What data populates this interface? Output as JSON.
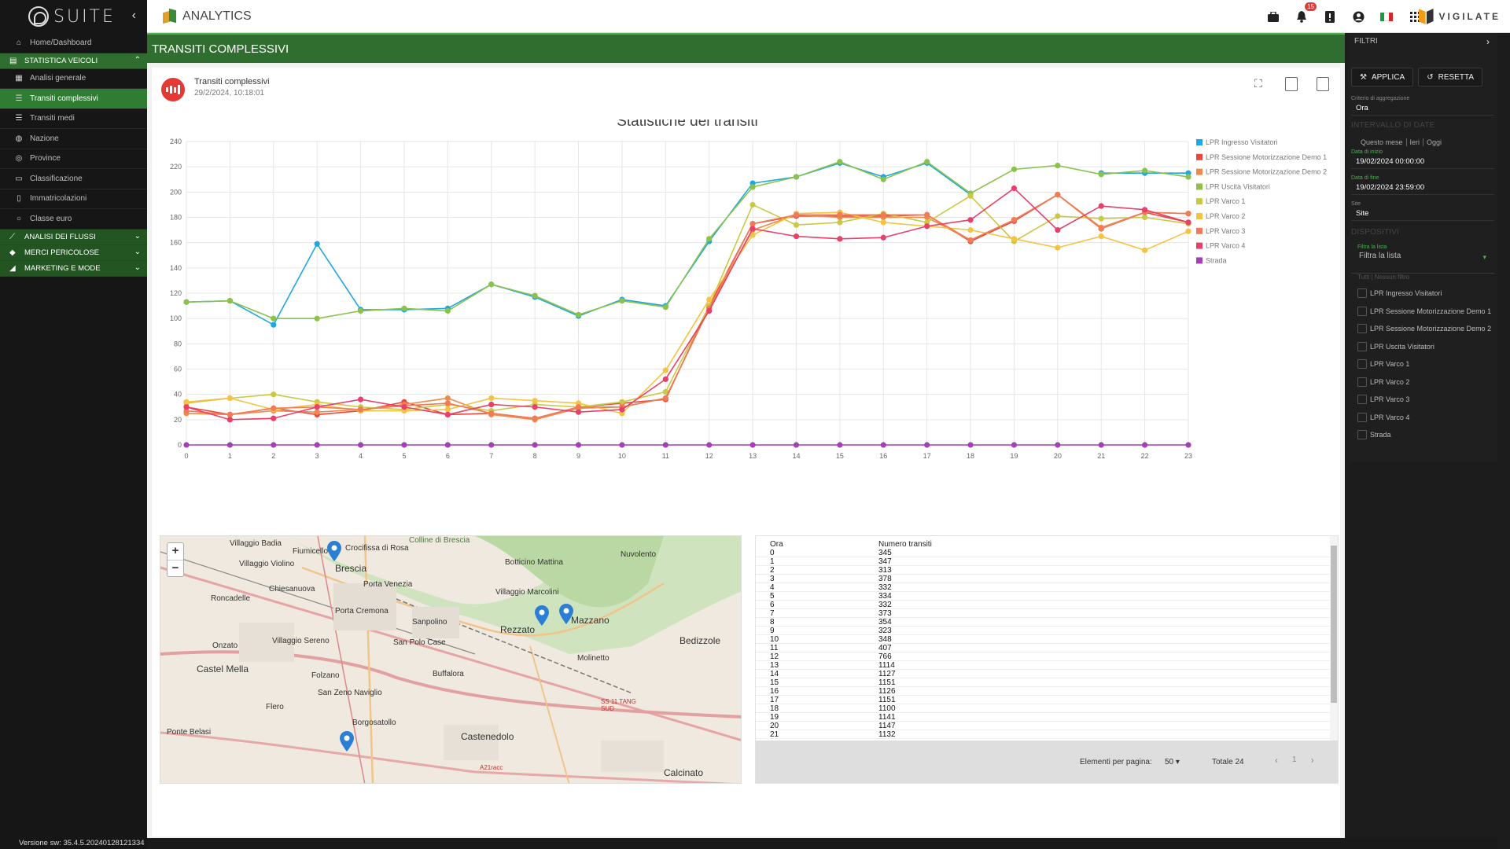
{
  "sidebar": {
    "logo": "SUITE",
    "items": [
      {
        "label": "Home/Dashboard",
        "icon": "home-icon"
      },
      {
        "label": "Analisi generale",
        "icon": "table-icon"
      },
      {
        "label": "Transiti complessivi",
        "icon": "list-icon",
        "active": true
      },
      {
        "label": "Transiti medi",
        "icon": "list-icon"
      },
      {
        "label": "Nazione",
        "icon": "globe-icon"
      },
      {
        "label": "Province",
        "icon": "target-icon"
      },
      {
        "label": "Classificazione",
        "icon": "truck-icon"
      },
      {
        "label": "Immatricolazioni",
        "icon": "doc-icon"
      },
      {
        "label": "Classe euro",
        "icon": "circle-icon"
      }
    ],
    "groups": {
      "statistica": "STATISTICA VEICOLI",
      "flussi": "ANALISI DEI FLUSSI",
      "merci": "MERCI PERICOLOSE",
      "marketing": "MARKETING E MODE"
    },
    "version": "Versione sw: 35.4.5.20240128121334"
  },
  "topbar": {
    "app_name": "ANALYTICS",
    "notifications_count": "15",
    "brand": "VIGILATE"
  },
  "page": {
    "title": "TRANSITI COMPLESSIVI",
    "card_title": "Transiti complessivi",
    "card_date": "29/2/2024, 10:18:01"
  },
  "chart_data": {
    "type": "line",
    "title": "Statistiche dei transiti",
    "x": [
      0,
      1,
      2,
      3,
      4,
      5,
      6,
      7,
      8,
      9,
      10,
      11,
      12,
      13,
      14,
      15,
      16,
      17,
      18,
      19,
      20,
      21,
      22,
      23
    ],
    "ylim": [
      0,
      240
    ],
    "yticks": [
      0,
      20,
      40,
      60,
      80,
      100,
      120,
      140,
      160,
      180,
      200,
      220,
      240
    ],
    "grid": true,
    "legend": "right",
    "series": [
      {
        "name": "LPR Ingresso Visitatori",
        "color": "#1ea7e1",
        "values": [
          113,
          114,
          95,
          159,
          107,
          107,
          108,
          127,
          117,
          102,
          115,
          110,
          161,
          207,
          212,
          223,
          212,
          223,
          198,
          null,
          null,
          215,
          215,
          215
        ]
      },
      {
        "name": "LPR Sessione Motorizzazione Demo 1",
        "color": "#e8493c",
        "values": [
          30,
          24,
          29,
          24,
          27,
          34,
          24,
          25,
          21,
          30,
          33,
          36,
          110,
          175,
          181,
          181,
          181,
          182,
          161,
          177,
          198,
          171,
          184,
          176
        ]
      },
      {
        "name": "LPR Sessione Motorizzazione Demo 2",
        "color": "#f08a4b",
        "values": [
          25,
          24,
          27,
          26,
          28,
          32,
          37,
          24,
          20,
          29,
          30,
          37,
          108,
          170,
          182,
          180,
          180,
          180,
          162,
          178,
          198,
          172,
          184,
          183
        ]
      },
      {
        "name": "LPR Uscita Visitatori",
        "color": "#8bc34a",
        "values": [
          113,
          114,
          100,
          100,
          106,
          108,
          106,
          127,
          118,
          103,
          114,
          109,
          163,
          204,
          212,
          224,
          210,
          224,
          199,
          218,
          221,
          214,
          217,
          212
        ]
      },
      {
        "name": "LPR Varco 1",
        "color": "#c9c943",
        "values": [
          33,
          37,
          40,
          34,
          30,
          28,
          32,
          27,
          32,
          30,
          34,
          42,
          110,
          190,
          174,
          176,
          183,
          176,
          197,
          161,
          181,
          179,
          180,
          175
        ]
      },
      {
        "name": "LPR Varco 2",
        "color": "#f5c242",
        "values": [
          34,
          37,
          28,
          32,
          27,
          27,
          28,
          37,
          35,
          33,
          25,
          59,
          115,
          166,
          183,
          184,
          176,
          173,
          170,
          163,
          156,
          165,
          154,
          169
        ]
      },
      {
        "name": "LPR Varco 3",
        "color": "#f07b55",
        "values": [
          27,
          24,
          29,
          30,
          28,
          31,
          33,
          25,
          21,
          30,
          30,
          37,
          108,
          175,
          182,
          182,
          182,
          182,
          162,
          178,
          198,
          171,
          184,
          183
        ]
      },
      {
        "name": "LPR Varco 4",
        "color": "#e93f6b",
        "values": [
          30,
          20,
          21,
          30,
          36,
          30,
          24,
          32,
          30,
          26,
          28,
          52,
          106,
          171,
          165,
          163,
          164,
          173,
          178,
          203,
          170,
          189,
          186,
          176
        ]
      },
      {
        "name": "Strada",
        "color": "#a43fb5",
        "values": [
          0,
          0,
          0,
          0,
          0,
          0,
          0,
          0,
          0,
          0,
          0,
          0,
          0,
          0,
          0,
          0,
          0,
          0,
          0,
          0,
          0,
          0,
          0,
          0
        ]
      }
    ]
  },
  "map": {
    "labels": [
      {
        "text": "Villaggio Badia",
        "big": false
      },
      {
        "text": "Fiumicello",
        "big": false
      },
      {
        "text": "Crocifissa di Rosa",
        "big": false
      },
      {
        "text": "Brescia",
        "big": true
      },
      {
        "text": "Colline di Brescia",
        "big": false
      },
      {
        "text": "Botticino Mattina",
        "big": false
      },
      {
        "text": "Nuvolento",
        "big": false
      },
      {
        "text": "Villaggio Violino",
        "big": false
      },
      {
        "text": "Chiesanuova",
        "big": false
      },
      {
        "text": "Porta Venezia",
        "big": false
      },
      {
        "text": "Villaggio Marcolini",
        "big": false
      },
      {
        "text": "Roncadelle",
        "big": false
      },
      {
        "text": "Porta Cremona",
        "big": false
      },
      {
        "text": "Sanpolino",
        "big": false
      },
      {
        "text": "Mazzano",
        "big": true
      },
      {
        "text": "Rezzato",
        "big": true
      },
      {
        "text": "Bedizzole",
        "big": true
      },
      {
        "text": "Onzato",
        "big": false
      },
      {
        "text": "Villaggio Sereno",
        "big": false
      },
      {
        "text": "San Polo Case",
        "big": false
      },
      {
        "text": "Castel Mella",
        "big": true
      },
      {
        "text": "Folzano",
        "big": false
      },
      {
        "text": "Buffalora",
        "big": false
      },
      {
        "text": "Molinetto",
        "big": false
      },
      {
        "text": "San Zeno Naviglio",
        "big": false
      },
      {
        "text": "Borgosatollo",
        "big": false
      },
      {
        "text": "Castenedolo",
        "big": true
      },
      {
        "text": "Flero",
        "big": false
      },
      {
        "text": "Ponte Belasi",
        "big": false
      },
      {
        "text": "Calcinato",
        "big": true
      },
      {
        "text": "SS 11 TANG SUD",
        "big": false
      },
      {
        "text": "A21racc",
        "big": false
      }
    ]
  },
  "table": {
    "col_ora": "Ora",
    "col_num": "Numero transiti",
    "rows": [
      [
        "0",
        "345"
      ],
      [
        "1",
        "347"
      ],
      [
        "2",
        "313"
      ],
      [
        "3",
        "378"
      ],
      [
        "4",
        "332"
      ],
      [
        "5",
        "334"
      ],
      [
        "6",
        "332"
      ],
      [
        "7",
        "373"
      ],
      [
        "8",
        "354"
      ],
      [
        "9",
        "323"
      ],
      [
        "10",
        "348"
      ],
      [
        "11",
        "407"
      ],
      [
        "12",
        "766"
      ],
      [
        "13",
        "1114"
      ],
      [
        "14",
        "1127"
      ],
      [
        "15",
        "1151"
      ],
      [
        "16",
        "1126"
      ],
      [
        "17",
        "1151"
      ],
      [
        "18",
        "1100"
      ],
      [
        "19",
        "1141"
      ],
      [
        "20",
        "1147"
      ],
      [
        "21",
        "1132"
      ]
    ],
    "per_page_label": "Elementi per pagina:",
    "per_page": "50",
    "total": "Totale 24",
    "page": "1"
  },
  "filters": {
    "title": "FILTRI",
    "apply": "APPLICA",
    "reset": "RESETTA",
    "aggregation_label": "Criterio di aggregazione",
    "aggregation_value": "Ora",
    "date_section": "INTERVALLO DI DATE",
    "date_tabs": [
      "Questo mese",
      "Ieri",
      "Oggi"
    ],
    "start_label": "Data di inizio",
    "start_value": "19/02/2024 00:00:00",
    "end_label": "Data di fine",
    "end_value": "19/02/2024 23:59:00",
    "site_label": "Site",
    "site_value": "Site",
    "devices_section": "DISPOSITIVI",
    "filter_list_label": "Filtra la lista",
    "filter_list_placeholder": "Filtra la lista",
    "sel_all": "Tutti",
    "sel_none": "Nessun filtro",
    "devices": [
      "LPR Ingresso Visitatori",
      "LPR Sessione Motorizzazione Demo 1",
      "LPR Sessione Motorizzazione Demo 2",
      "LPR Uscita Visitatori",
      "LPR Varco 1",
      "LPR Varco 2",
      "LPR Varco 3",
      "LPR Varco 4",
      "Strada"
    ]
  }
}
